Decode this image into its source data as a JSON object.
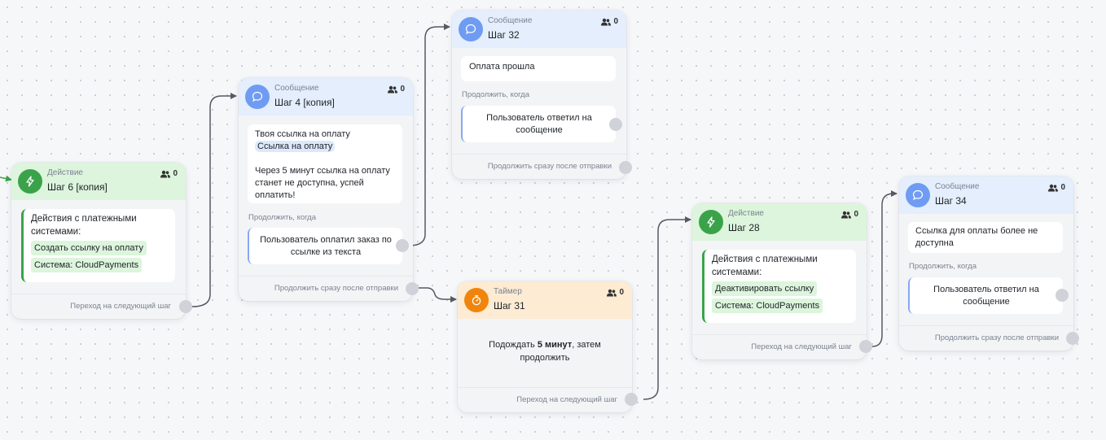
{
  "nodes": {
    "step6": {
      "type": "Действие",
      "title": "Шаг 6 [копия]",
      "count": "0",
      "card_title": "Действия с платежными системами:",
      "pill1": "Создать ссылку на оплату",
      "pill2": "Система: CloudPayments",
      "footer": "Переход на следующий шаг"
    },
    "step4": {
      "type": "Сообщение",
      "title": "Шаг 4 [копия]",
      "count": "0",
      "msg_line1": "Твоя ссылка на оплату",
      "msg_link": "Ссылка на оплату",
      "msg_line2": "Через 5 минут ссылка на оплату станет не доступна, успей оплатить!",
      "continue_label": "Продолжить, когда",
      "condition": "Пользователь оплатил заказ по ссылке из текста",
      "footer": "Продолжить сразу после отправки"
    },
    "step32": {
      "type": "Сообщение",
      "title": "Шаг 32",
      "count": "0",
      "msg": "Оплата прошла",
      "continue_label": "Продолжить, когда",
      "condition": "Пользователь ответил на сообщение",
      "footer": "Продолжить сразу после отправки"
    },
    "step31": {
      "type": "Таймер",
      "title": "Шаг 31",
      "count": "0",
      "wait_prefix": "Подождать ",
      "wait_value": "5 минут",
      "wait_suffix": ", затем продолжить",
      "footer": "Переход на следующий шаг"
    },
    "step28": {
      "type": "Действие",
      "title": "Шаг 28",
      "count": "0",
      "card_title": "Действия с платежными системами:",
      "pill1": "Деактивировать ссылку",
      "pill2": "Система: CloudPayments",
      "footer": "Переход на следующий шаг"
    },
    "step34": {
      "type": "Сообщение",
      "title": "Шаг 34",
      "count": "0",
      "msg": "Ссылка для оплаты более не доступна",
      "continue_label": "Продолжить, когда",
      "condition": "Пользователь ответил на сообщение",
      "footer": "Продолжить сразу после отправки"
    }
  },
  "colors": {
    "action": "#3aa34a",
    "message": "#6f9cf2",
    "timer": "#f0850e",
    "wire": "#555a63"
  }
}
